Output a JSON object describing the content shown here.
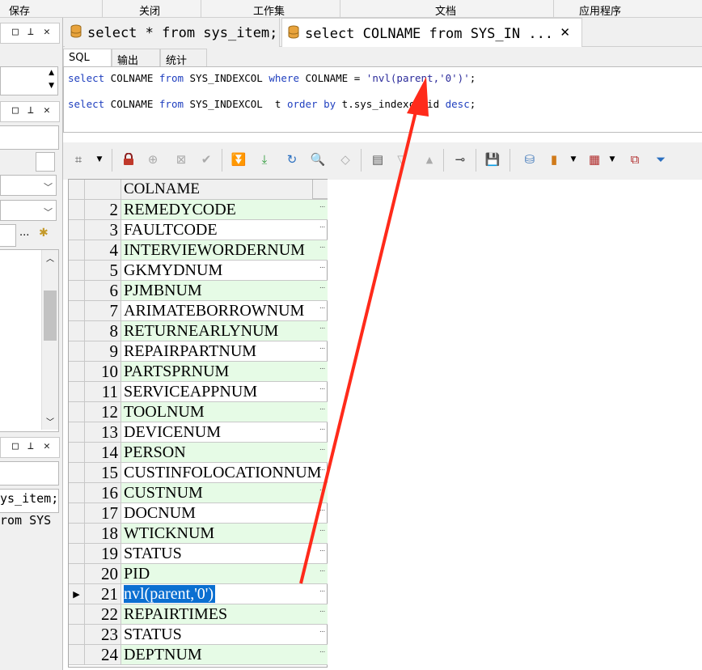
{
  "menu": [
    "保存",
    "关闭",
    "工作集",
    "文档",
    "应用程序"
  ],
  "doc_tabs": [
    {
      "label": "select * from sys_item;"
    },
    {
      "label": "select COLNAME from SYS_IN ...",
      "close": "✕"
    }
  ],
  "left_panel": {
    "pane_buttons": [
      "□",
      "⊥",
      "✕"
    ],
    "dots": "...",
    "text_lines": [
      "ys_item;",
      "rom SYS"
    ]
  },
  "sub_tabs": [
    "SQL",
    "输出",
    "统计"
  ],
  "sql": {
    "line1": {
      "kw1": "select",
      "t1": " COLNAME ",
      "kw2": "from",
      "t2": " SYS_INDEXCOL ",
      "kw3": "where",
      "t3": " COLNAME = ",
      "s": "'nvl(parent,'0')'",
      "t4": ";"
    },
    "line2": {
      "kw1": "select",
      "t1": " COLNAME ",
      "kw2": "from",
      "t2": " SYS_INDEXCOL  t ",
      "kw3": "order by",
      "t3": " t.sys_indexcolid ",
      "kw4": "desc",
      "t4": ";"
    }
  },
  "grid": {
    "column_header": "COLNAME",
    "selected_indicator": "▶",
    "cell_button": "...",
    "rows": [
      {
        "num": "2",
        "value": "REMEDYCODE"
      },
      {
        "num": "3",
        "value": "FAULTCODE"
      },
      {
        "num": "4",
        "value": "INTERVIEWORDERNUM"
      },
      {
        "num": "5",
        "value": "GKMYDNUM"
      },
      {
        "num": "6",
        "value": "PJMBNUM"
      },
      {
        "num": "7",
        "value": "ARIMATEBORROWNUM"
      },
      {
        "num": "8",
        "value": "RETURNEARLYNUM"
      },
      {
        "num": "9",
        "value": "REPAIRPARTNUM"
      },
      {
        "num": "10",
        "value": "PARTSPRNUM"
      },
      {
        "num": "11",
        "value": "SERVICEAPPNUM"
      },
      {
        "num": "12",
        "value": "TOOLNUM"
      },
      {
        "num": "13",
        "value": "DEVICENUM"
      },
      {
        "num": "14",
        "value": "PERSON"
      },
      {
        "num": "15",
        "value": "CUSTINFOLOCATIONNUM"
      },
      {
        "num": "16",
        "value": "CUSTNUM"
      },
      {
        "num": "17",
        "value": "DOCNUM"
      },
      {
        "num": "18",
        "value": "WTICKNUM"
      },
      {
        "num": "19",
        "value": "STATUS"
      },
      {
        "num": "20",
        "value": "PID"
      },
      {
        "num": "21",
        "value": "nvl(parent,'0')"
      },
      {
        "num": "22",
        "value": "REPAIRTIMES"
      },
      {
        "num": "23",
        "value": "STATUS"
      },
      {
        "num": "24",
        "value": "DEPTNUM"
      }
    ]
  },
  "colors": {
    "row_green": "#e6fbe6",
    "selection": "#0b6fd1",
    "keyword": "#1f3fbf",
    "arrow": "#ff2a1a"
  }
}
